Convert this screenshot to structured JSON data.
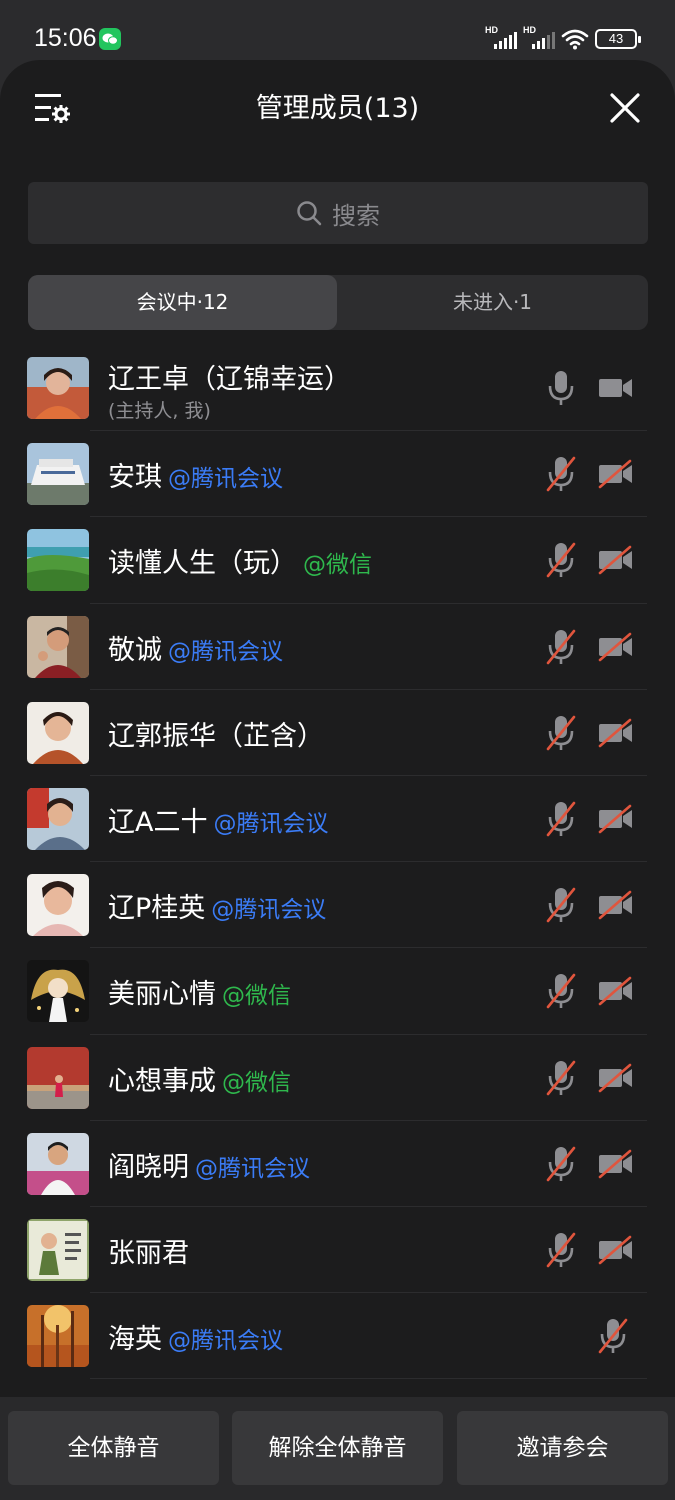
{
  "status_bar": {
    "time": "15:06",
    "network_label": "HD",
    "battery": "43",
    "icons": [
      "wechat-notification-icon",
      "signal-icon",
      "wifi-icon",
      "battery-icon"
    ]
  },
  "header": {
    "title": "管理成员(13)",
    "settings_icon": "list-settings-icon",
    "close_icon": "close-icon"
  },
  "search": {
    "placeholder": "搜索"
  },
  "tabs": [
    {
      "label": "会议中·12",
      "active": true
    },
    {
      "label": "未进入·1",
      "active": false
    }
  ],
  "colors": {
    "tencent_tag": "#3b7cf6",
    "wechat_tag": "#2fb84d",
    "muted_slash": "#e0553d"
  },
  "members": [
    {
      "name": "辽王卓（辽锦幸运）",
      "tag": "",
      "role": "(主持人, 我)",
      "mic": "on",
      "camera": "off"
    },
    {
      "name": "安琪",
      "tag": "@腾讯会议",
      "tag_type": "tencent",
      "mic": "muted",
      "camera": "muted"
    },
    {
      "name": "读懂人生（玩）",
      "tag": "@微信",
      "tag_type": "wechat",
      "mic": "muted",
      "camera": "muted"
    },
    {
      "name": "敬诚",
      "tag": "@腾讯会议",
      "tag_type": "tencent",
      "mic": "muted",
      "camera": "muted"
    },
    {
      "name": "辽郭振华（芷含）",
      "tag": "",
      "mic": "muted",
      "camera": "muted"
    },
    {
      "name": "辽A二十",
      "tag": "@腾讯会议",
      "tag_type": "tencent",
      "mic": "muted",
      "camera": "muted"
    },
    {
      "name": "辽P桂英",
      "tag": "@腾讯会议",
      "tag_type": "tencent",
      "mic": "muted",
      "camera": "muted"
    },
    {
      "name": "美丽心情",
      "tag": "@微信",
      "tag_type": "wechat",
      "mic": "muted",
      "camera": "muted"
    },
    {
      "name": "心想事成",
      "tag": "@微信",
      "tag_type": "wechat",
      "mic": "muted",
      "camera": "muted"
    },
    {
      "name": "阎晓明",
      "tag": "@腾讯会议",
      "tag_type": "tencent",
      "mic": "muted",
      "camera": "muted"
    },
    {
      "name": "张丽君",
      "tag": "",
      "mic": "muted",
      "camera": "muted"
    },
    {
      "name": "海英",
      "tag": "@腾讯会议",
      "tag_type": "tencent",
      "mic": "muted",
      "camera": "none"
    }
  ],
  "footer": {
    "mute_all": "全体静音",
    "unmute_all": "解除全体静音",
    "invite": "邀请参会"
  }
}
